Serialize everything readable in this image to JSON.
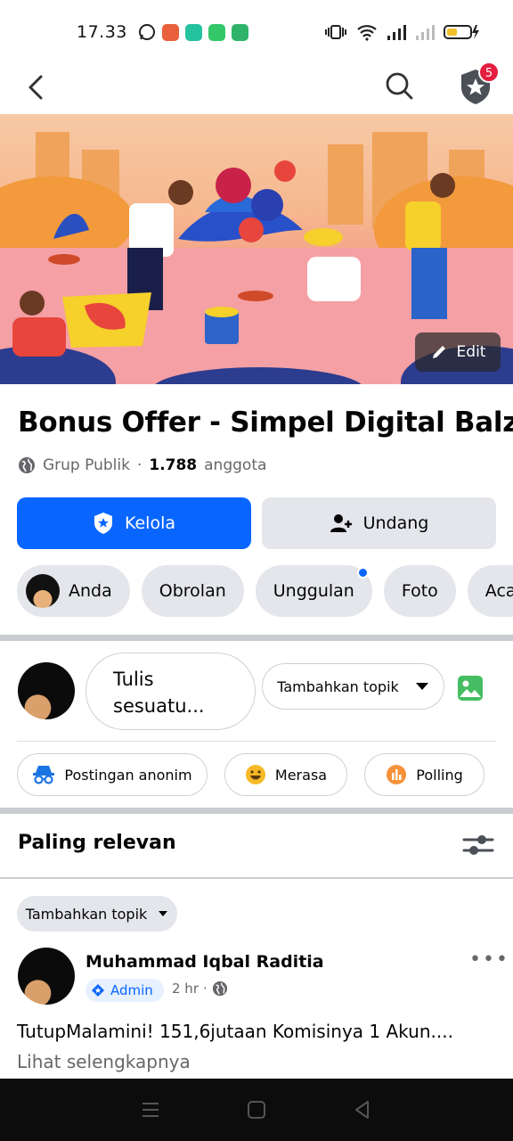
{
  "status_bar": {
    "time": "17.33"
  },
  "nav": {
    "notification_count": "5"
  },
  "cover": {
    "edit_label": "Edit"
  },
  "group": {
    "name": "Bonus Offer - Simpel Digital Balz",
    "chevron": "›",
    "privacy": "Grup Publik",
    "separator": "·",
    "member_count": "1.788",
    "member_label": "anggota"
  },
  "actions": {
    "manage_label": "Kelola",
    "invite_label": "Undang"
  },
  "tabs": [
    {
      "label": "Anda"
    },
    {
      "label": "Obrolan"
    },
    {
      "label": "Unggulan"
    },
    {
      "label": "Foto"
    },
    {
      "label": "Acara"
    }
  ],
  "composer": {
    "placeholder_line1": "Tulis",
    "placeholder_line2": "sesuatu...",
    "topic_label": "Tambahkan topik"
  },
  "quick_actions": [
    {
      "label": "Postingan anonim"
    },
    {
      "label": "Merasa"
    },
    {
      "label": "Polling"
    }
  ],
  "feed": {
    "sort_label": "Paling relevan",
    "topic_filter": "Tambahkan topik"
  },
  "post": {
    "author": "Muhammad Iqbal Raditia",
    "role": "Admin",
    "time": "2 hr",
    "dot": "·",
    "text": "TutupMalamini! 151,6jutaan Komisinya 1 Akun....",
    "see_more": "Lihat selengkapnya",
    "more_icon": "•••"
  },
  "colors": {
    "primary": "#0866ff",
    "chip_bg": "#e4e6eb",
    "badge": "#e41e3f"
  }
}
